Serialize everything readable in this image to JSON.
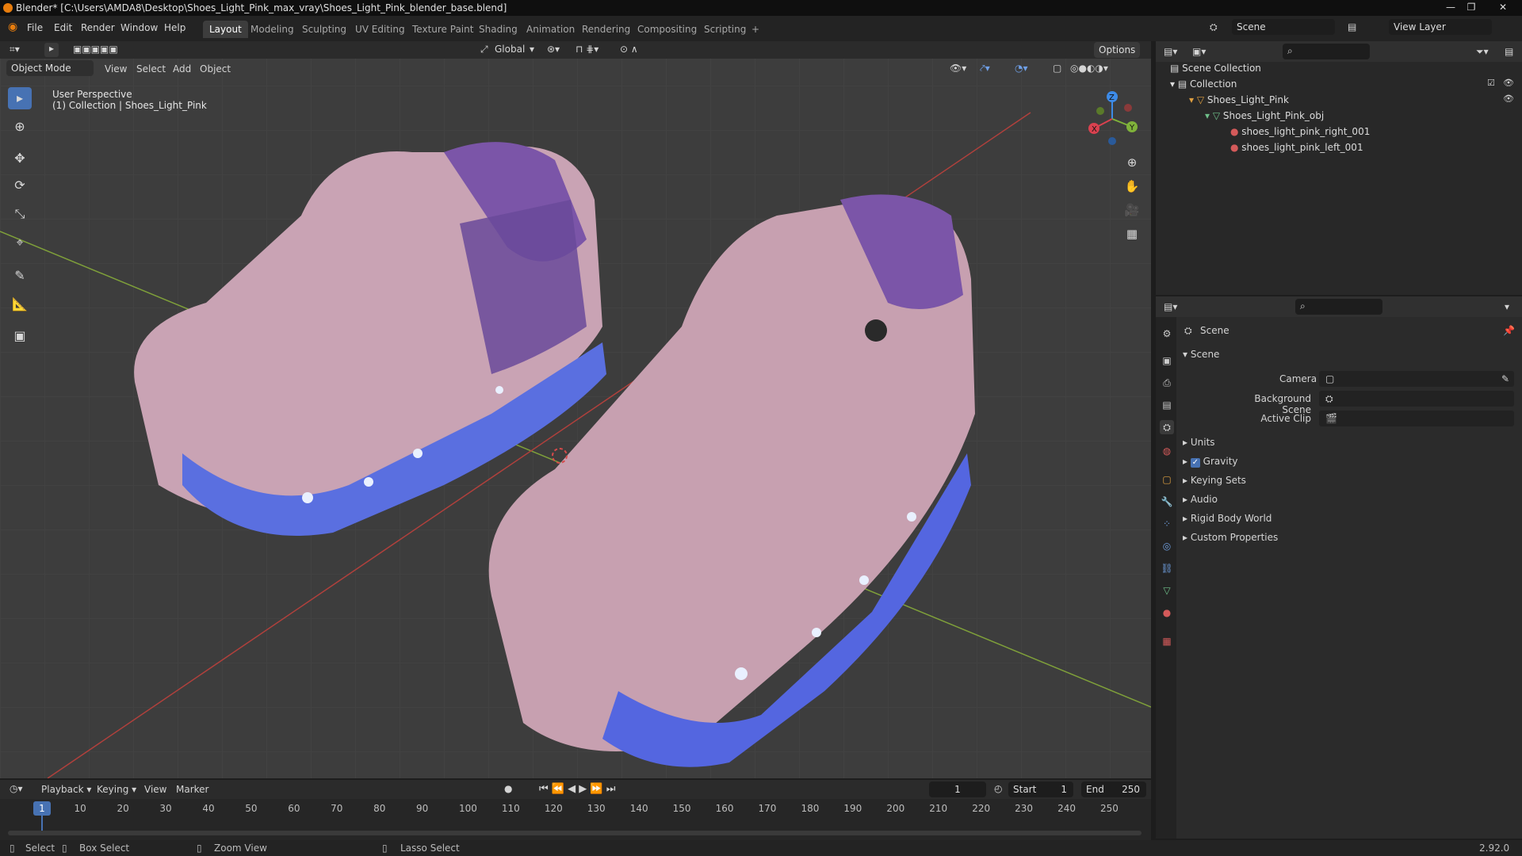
{
  "titlebar": {
    "title": "Blender* [C:\\Users\\AMDA8\\Desktop\\Shoes_Light_Pink_max_vray\\Shoes_Light_Pink_blender_base.blend]"
  },
  "menu": {
    "file": "File",
    "edit": "Edit",
    "render": "Render",
    "window": "Window",
    "help": "Help"
  },
  "workspaces": [
    "Layout",
    "Modeling",
    "Sculpting",
    "UV Editing",
    "Texture Paint",
    "Shading",
    "Animation",
    "Rendering",
    "Compositing",
    "Scripting",
    "+"
  ],
  "scene_field": "Scene",
  "view_layer_field": "View Layer",
  "viewport_header": {
    "orientation": "Global",
    "options": "Options",
    "mode": "Object Mode",
    "view": "View",
    "select": "Select",
    "add": "Add",
    "object": "Object"
  },
  "viewport": {
    "perspective": "User Perspective",
    "collection_info": "(1) Collection | Shoes_Light_Pink",
    "gizmo": {
      "z": "Z",
      "y": "Y",
      "x": "X"
    }
  },
  "outliner": {
    "rows": [
      "Scene Collection",
      "Collection",
      "Shoes_Light_Pink",
      "Shoes_Light_Pink_obj",
      "shoes_light_pink_right_001",
      "shoes_light_pink_left_001"
    ]
  },
  "properties": {
    "context": "Scene",
    "panel_title": "Scene",
    "camera_label": "Camera",
    "background_scene_label": "Background Scene",
    "active_clip_label": "Active Clip",
    "subpanels": [
      "Units",
      "Gravity",
      "Keying Sets",
      "Audio",
      "Rigid Body World",
      "Custom Properties"
    ],
    "gravity_checked": true
  },
  "timeline": {
    "playback": "Playback",
    "keying": "Keying",
    "view": "View",
    "marker": "Marker",
    "current_frame": "1",
    "start_label": "Start",
    "start_value": "1",
    "end_label": "End",
    "end_value": "250",
    "ticks": [
      "1",
      "10",
      "20",
      "30",
      "40",
      "50",
      "60",
      "70",
      "80",
      "90",
      "100",
      "110",
      "120",
      "130",
      "140",
      "150",
      "160",
      "170",
      "180",
      "190",
      "200",
      "210",
      "220",
      "230",
      "240",
      "250"
    ]
  },
  "statusbar": {
    "select": "Select",
    "box_select": "Box Select",
    "zoom_view": "Zoom View",
    "lasso_select": "Lasso Select",
    "version": "2.92.0"
  },
  "colors": {
    "accent": "#4772b3",
    "shoe_pink": "#c9a3b4",
    "sole_blue": "#5a6fe0",
    "lining_purple": "#7b55a8",
    "x_axis": "#d9414f",
    "y_axis": "#7fb23a",
    "z_axis": "#3d8be8"
  }
}
